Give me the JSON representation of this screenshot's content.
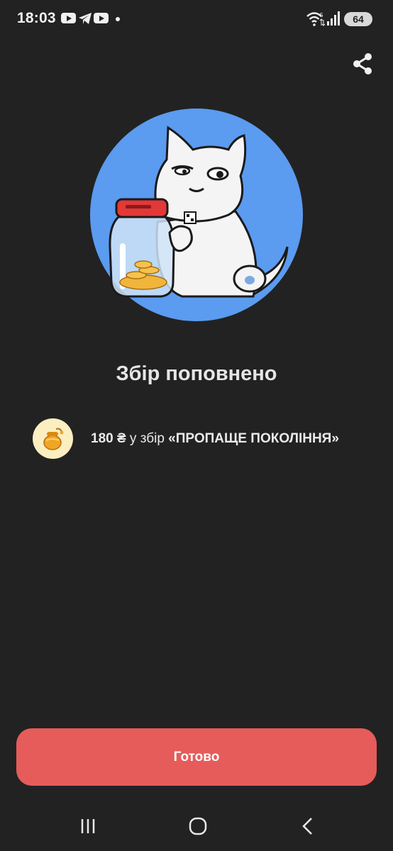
{
  "status_bar": {
    "time": "18:03",
    "battery": "64",
    "icons": [
      "youtube-icon",
      "telegram-icon",
      "youtube-icon",
      "notification-dot",
      "wifi-icon",
      "signal-icon",
      "battery-icon"
    ]
  },
  "header": {
    "share_icon": "share-icon"
  },
  "hero": {
    "illustration": "cat-with-jar-illustration",
    "background_color": "#5b9bf0"
  },
  "main": {
    "title": "Збір поповнено",
    "amount": "180 ₴",
    "description_prefix": " у збір ",
    "jar_name": "«ПРОПАЩЕ ПОКОЛІННЯ»",
    "jar_icon": "honey-jar-icon"
  },
  "footer": {
    "done_label": "Готово",
    "done_color": "#e65c5a"
  },
  "nav": {
    "recents_icon": "recents-icon",
    "home_icon": "home-icon",
    "back_icon": "back-icon"
  }
}
